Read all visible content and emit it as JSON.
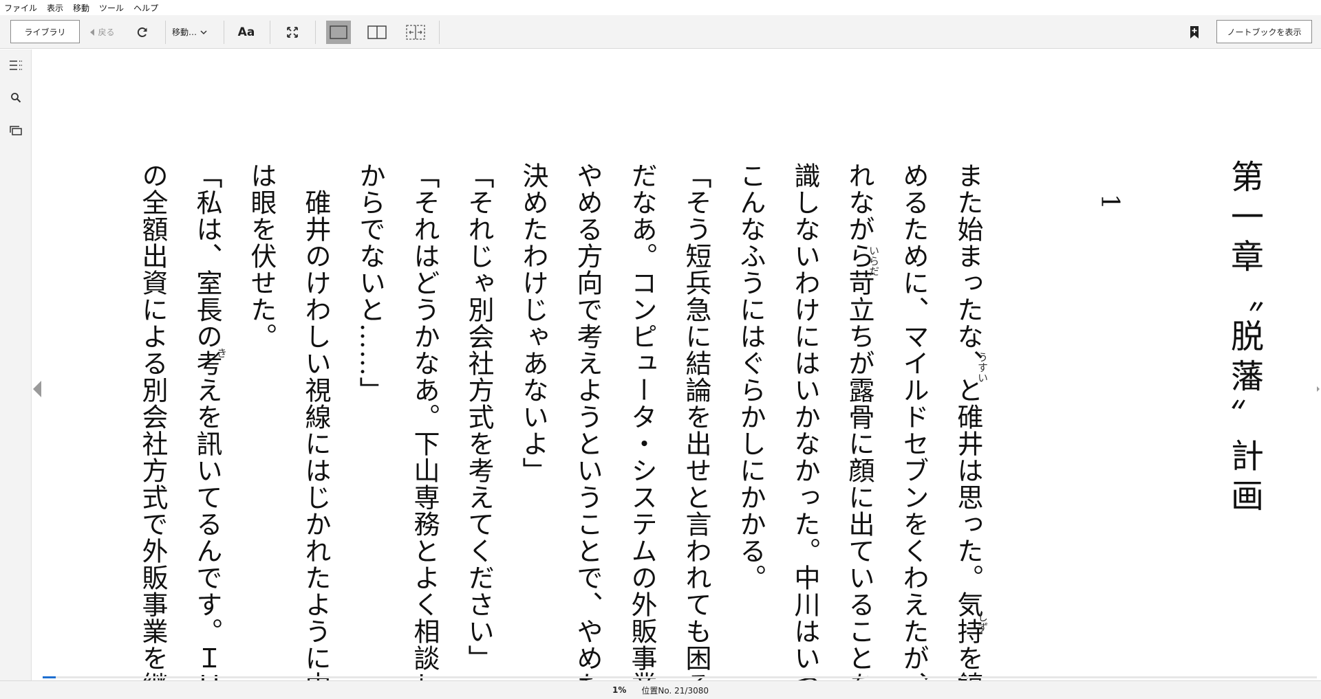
{
  "menu": [
    "ファイル",
    "表示",
    "移動",
    "ツール",
    "ヘルプ"
  ],
  "toolbar": {
    "library_label": "ライブラリ",
    "back_label": "戻る",
    "goto_label": "移動…",
    "font_label": "Aa",
    "notebook_label": "ノートブックを表示"
  },
  "book": {
    "title": "第一章〝脱藩〟計画",
    "section_number": "1",
    "ruby": {
      "usui": "うすい",
      "shizu": "しず",
      "irada": "いらだ",
      "ki": "き"
    },
    "columns": [
      "また始まったな、と碓井は思った。気持を鎮",
      "めるために、マイルドセブンをくわえたが、わ",
      "れながら苛立ちが露骨に顔に出ていることを意",
      "識しないわけにはいかなかった。中川はいつも",
      "こんなふうにはぐらかしにかかる。",
      "「そう短兵急に結論を出せと言われても困るん",
      "だなあ。コンピュータ・システムの外販事業を",
      "やめる方向で考えようということで、やめたと",
      "決めたわけじゃあないよ」",
      "「それじゃ別会社方式を考えてください」",
      "「それはどうかなあ。下山専務とよく相談して",
      "からでないと……」",
      "　碓井のけわしい視線にはじかれたように中川",
      "は眼を伏せた。",
      "「私は、室長の考えを訊いてるんです。ＩＨＩ",
      "の全額出資による別会社方式で外販事業を継続"
    ]
  },
  "status": {
    "percent_label": "1%",
    "location_label": "位置No. 21/3080",
    "progress_fraction": 0.01
  },
  "colors": {
    "accent": "#1e6fd0",
    "toolbar_bg": "#f3f3f3",
    "page_bg": "#ffffff",
    "active_view": "#a6a6a6"
  },
  "icons": [
    "refresh-icon",
    "fullscreen-icon",
    "single-page-view-icon",
    "two-page-view-icon",
    "scroll-view-icon",
    "bookmark-add-icon",
    "toc-icon",
    "search-icon",
    "flashcards-icon",
    "prev-page-icon",
    "next-page-icon"
  ]
}
